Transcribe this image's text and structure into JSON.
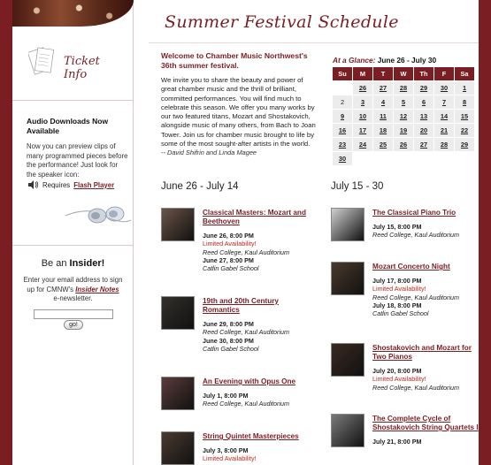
{
  "sidebar": {
    "ticket_info": "Ticket Info",
    "audio_title": "Audio Downloads Now Available",
    "audio_text": "Now you can preview clips of many programmed pieces before the performance! Just look for the speaker icon:",
    "requires": "Requires",
    "flash_link": "Flash Player",
    "insider_prefix": "Be an",
    "insider_bold": "Insider!",
    "insider_text_1": "Enter your email address to sign up for CMNW's",
    "insider_link": "Insider Notes",
    "insider_text_2": "e-newsletter.",
    "email_value": "",
    "go_label": "go!"
  },
  "main": {
    "title": "Summer Festival Schedule",
    "welcome": "Welcome to Chamber Music Northwest's 36th summer festival.",
    "intro": "We invite you to share the beauty and power of great chamber music and the thrill of brilliant, committed performances. You will find much to celebrate this season. We offer you many works by our two featured titans, Mozart and Shostakovich, alongside music of many others, from Bach to Joan Tower. Join us for chamber music brought to life by some of the most sought-after artists in the world.",
    "signature": "-- David Shifrin and Linda Magee",
    "glance_label": "At a Glance:",
    "glance_range": "June 26 - July 30",
    "calendar": {
      "days": [
        "Su",
        "M",
        "T",
        "W",
        "Th",
        "F",
        "Sa"
      ],
      "rows": [
        [
          "",
          "26",
          "27",
          "28",
          "29",
          "30",
          "1"
        ],
        [
          "2",
          "3",
          "4",
          "5",
          "6",
          "7",
          "8"
        ],
        [
          "9",
          "10",
          "11",
          "12",
          "13",
          "14",
          "15"
        ],
        [
          "16",
          "17",
          "18",
          "19",
          "20",
          "21",
          "22"
        ],
        [
          "23",
          "24",
          "25",
          "26",
          "27",
          "28",
          "29"
        ],
        [
          "30",
          "",
          "",
          "",
          "",
          "",
          ""
        ]
      ],
      "plain": [
        "2"
      ]
    },
    "col1_head": "June 26 - July 14",
    "col2_head": "July 15 - 30",
    "col1_events": [
      {
        "title": "Classical Masters: Mozart and Beethoven",
        "lines": [
          [
            "date",
            "June 26, 8:00 PM"
          ],
          [
            "warn",
            "Limited Availability!"
          ],
          [
            "venue",
            "Reed College, Kaul Auditorium"
          ],
          [
            "date2",
            "June 27, 8:00 PM"
          ],
          [
            "venue",
            "Catlin Gabel School"
          ]
        ]
      },
      {
        "title": "19th and 20th Century Romantics",
        "lines": [
          [
            "date",
            "June 29, 8:00 PM"
          ],
          [
            "venue",
            "Reed College, Kaul Auditorium"
          ],
          [
            "date2",
            "June 30, 8:00 PM"
          ],
          [
            "venue",
            "Catlin Gabel School"
          ]
        ]
      },
      {
        "title": "An Evening with Opus One",
        "lines": [
          [
            "date",
            "July 1, 8:00 PM"
          ],
          [
            "venue",
            "Reed College, Kaul Auditorium"
          ]
        ]
      },
      {
        "title": "String Quintet Masterpieces",
        "lines": [
          [
            "date",
            "July 3, 8:00 PM"
          ],
          [
            "warn",
            "Limited Availability!"
          ]
        ]
      }
    ],
    "col2_events": [
      {
        "title": "The Classical Piano Trio",
        "lines": [
          [
            "date",
            "July 15, 8:00 PM"
          ],
          [
            "venue",
            "Reed College, Kaul Auditorium"
          ]
        ]
      },
      {
        "title": "Mozart Concerto Night",
        "lines": [
          [
            "date",
            "July 17, 8:00 PM"
          ],
          [
            "warn",
            "Limited Availability!"
          ],
          [
            "venue",
            "Reed College, Kaul Auditorium"
          ],
          [
            "date2",
            "July 18, 8:00 PM"
          ],
          [
            "venue",
            "Catlin Gabel School"
          ]
        ]
      },
      {
        "title": "Shostakovich and Mozart for Two Pianos",
        "lines": [
          [
            "date",
            "July 20, 8:00 PM"
          ],
          [
            "warn",
            "Limited Availability!"
          ],
          [
            "venue",
            "Reed College, Kaul Auditorium"
          ]
        ]
      },
      {
        "title": "The Complete Cycle of Shostakovich String Quartets I",
        "lines": [
          [
            "date",
            "July 21, 8:00 PM"
          ]
        ]
      }
    ]
  },
  "colors": {
    "accent": "#7a1e24",
    "warning": "#c0281f",
    "calendar_header": "#7a1e24"
  }
}
